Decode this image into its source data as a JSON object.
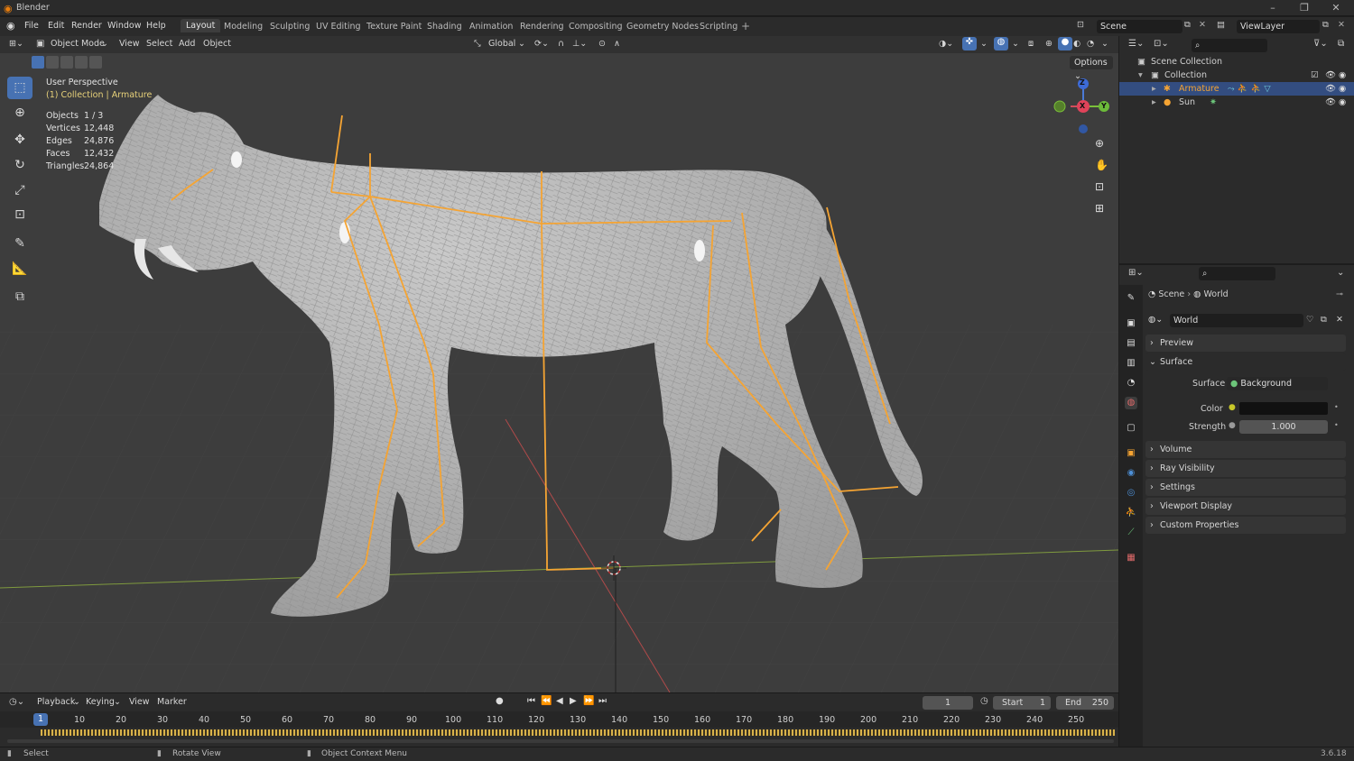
{
  "app": {
    "title": "Blender",
    "version": "3.6.18"
  },
  "menu": [
    "File",
    "Edit",
    "Render",
    "Window",
    "Help"
  ],
  "workspaces": [
    "Layout",
    "Modeling",
    "Sculpting",
    "UV Editing",
    "Texture Paint",
    "Shading",
    "Animation",
    "Rendering",
    "Compositing",
    "Geometry Nodes",
    "Scripting"
  ],
  "scene_name": "Scene",
  "view_layer": "ViewLayer",
  "viewport": {
    "mode": "Object Mode",
    "menus": [
      "View",
      "Select",
      "Add",
      "Object"
    ],
    "transform_orientation": "Global",
    "options_label": "Options",
    "perspective": "User Perspective",
    "context": "(1) Collection | Armature",
    "stats": [
      {
        "label": "Objects",
        "value": "1 / 3"
      },
      {
        "label": "Vertices",
        "value": "12,448"
      },
      {
        "label": "Edges",
        "value": "24,876"
      },
      {
        "label": "Faces",
        "value": "12,432"
      },
      {
        "label": "Triangles",
        "value": "24,864"
      }
    ],
    "gizmo": {
      "z": "Z",
      "x": "X",
      "y": "Y"
    }
  },
  "outliner": {
    "root": "Scene Collection",
    "collection": "Collection",
    "items": [
      "Armature",
      "Sun"
    ]
  },
  "properties": {
    "breadcrumb": [
      "Scene",
      "World"
    ],
    "world_name": "World",
    "sections": [
      "Preview",
      "Surface",
      "Volume",
      "Ray Visibility",
      "Settings",
      "Viewport Display",
      "Custom Properties"
    ],
    "surface_label": "Surface",
    "surface_value": "Background",
    "color_label": "Color",
    "strength_label": "Strength",
    "strength_value": "1.000"
  },
  "timeline": {
    "menus": [
      "Playback",
      "Keying",
      "View",
      "Marker"
    ],
    "current_frame": "1",
    "start_label": "Start",
    "start": "1",
    "end_label": "End",
    "end": "250",
    "ticks": [
      "1",
      "10",
      "20",
      "30",
      "40",
      "50",
      "60",
      "70",
      "80",
      "90",
      "100",
      "110",
      "120",
      "130",
      "140",
      "150",
      "160",
      "170",
      "180",
      "190",
      "200",
      "210",
      "220",
      "230",
      "240",
      "250"
    ]
  },
  "statusbar": [
    "Select",
    "Rotate View",
    "Object Context Menu"
  ],
  "colors": {
    "accent": "#4772b3",
    "bone": "#f5a433",
    "mesh": "#b4b4b4",
    "background": "#3d3d3d"
  }
}
